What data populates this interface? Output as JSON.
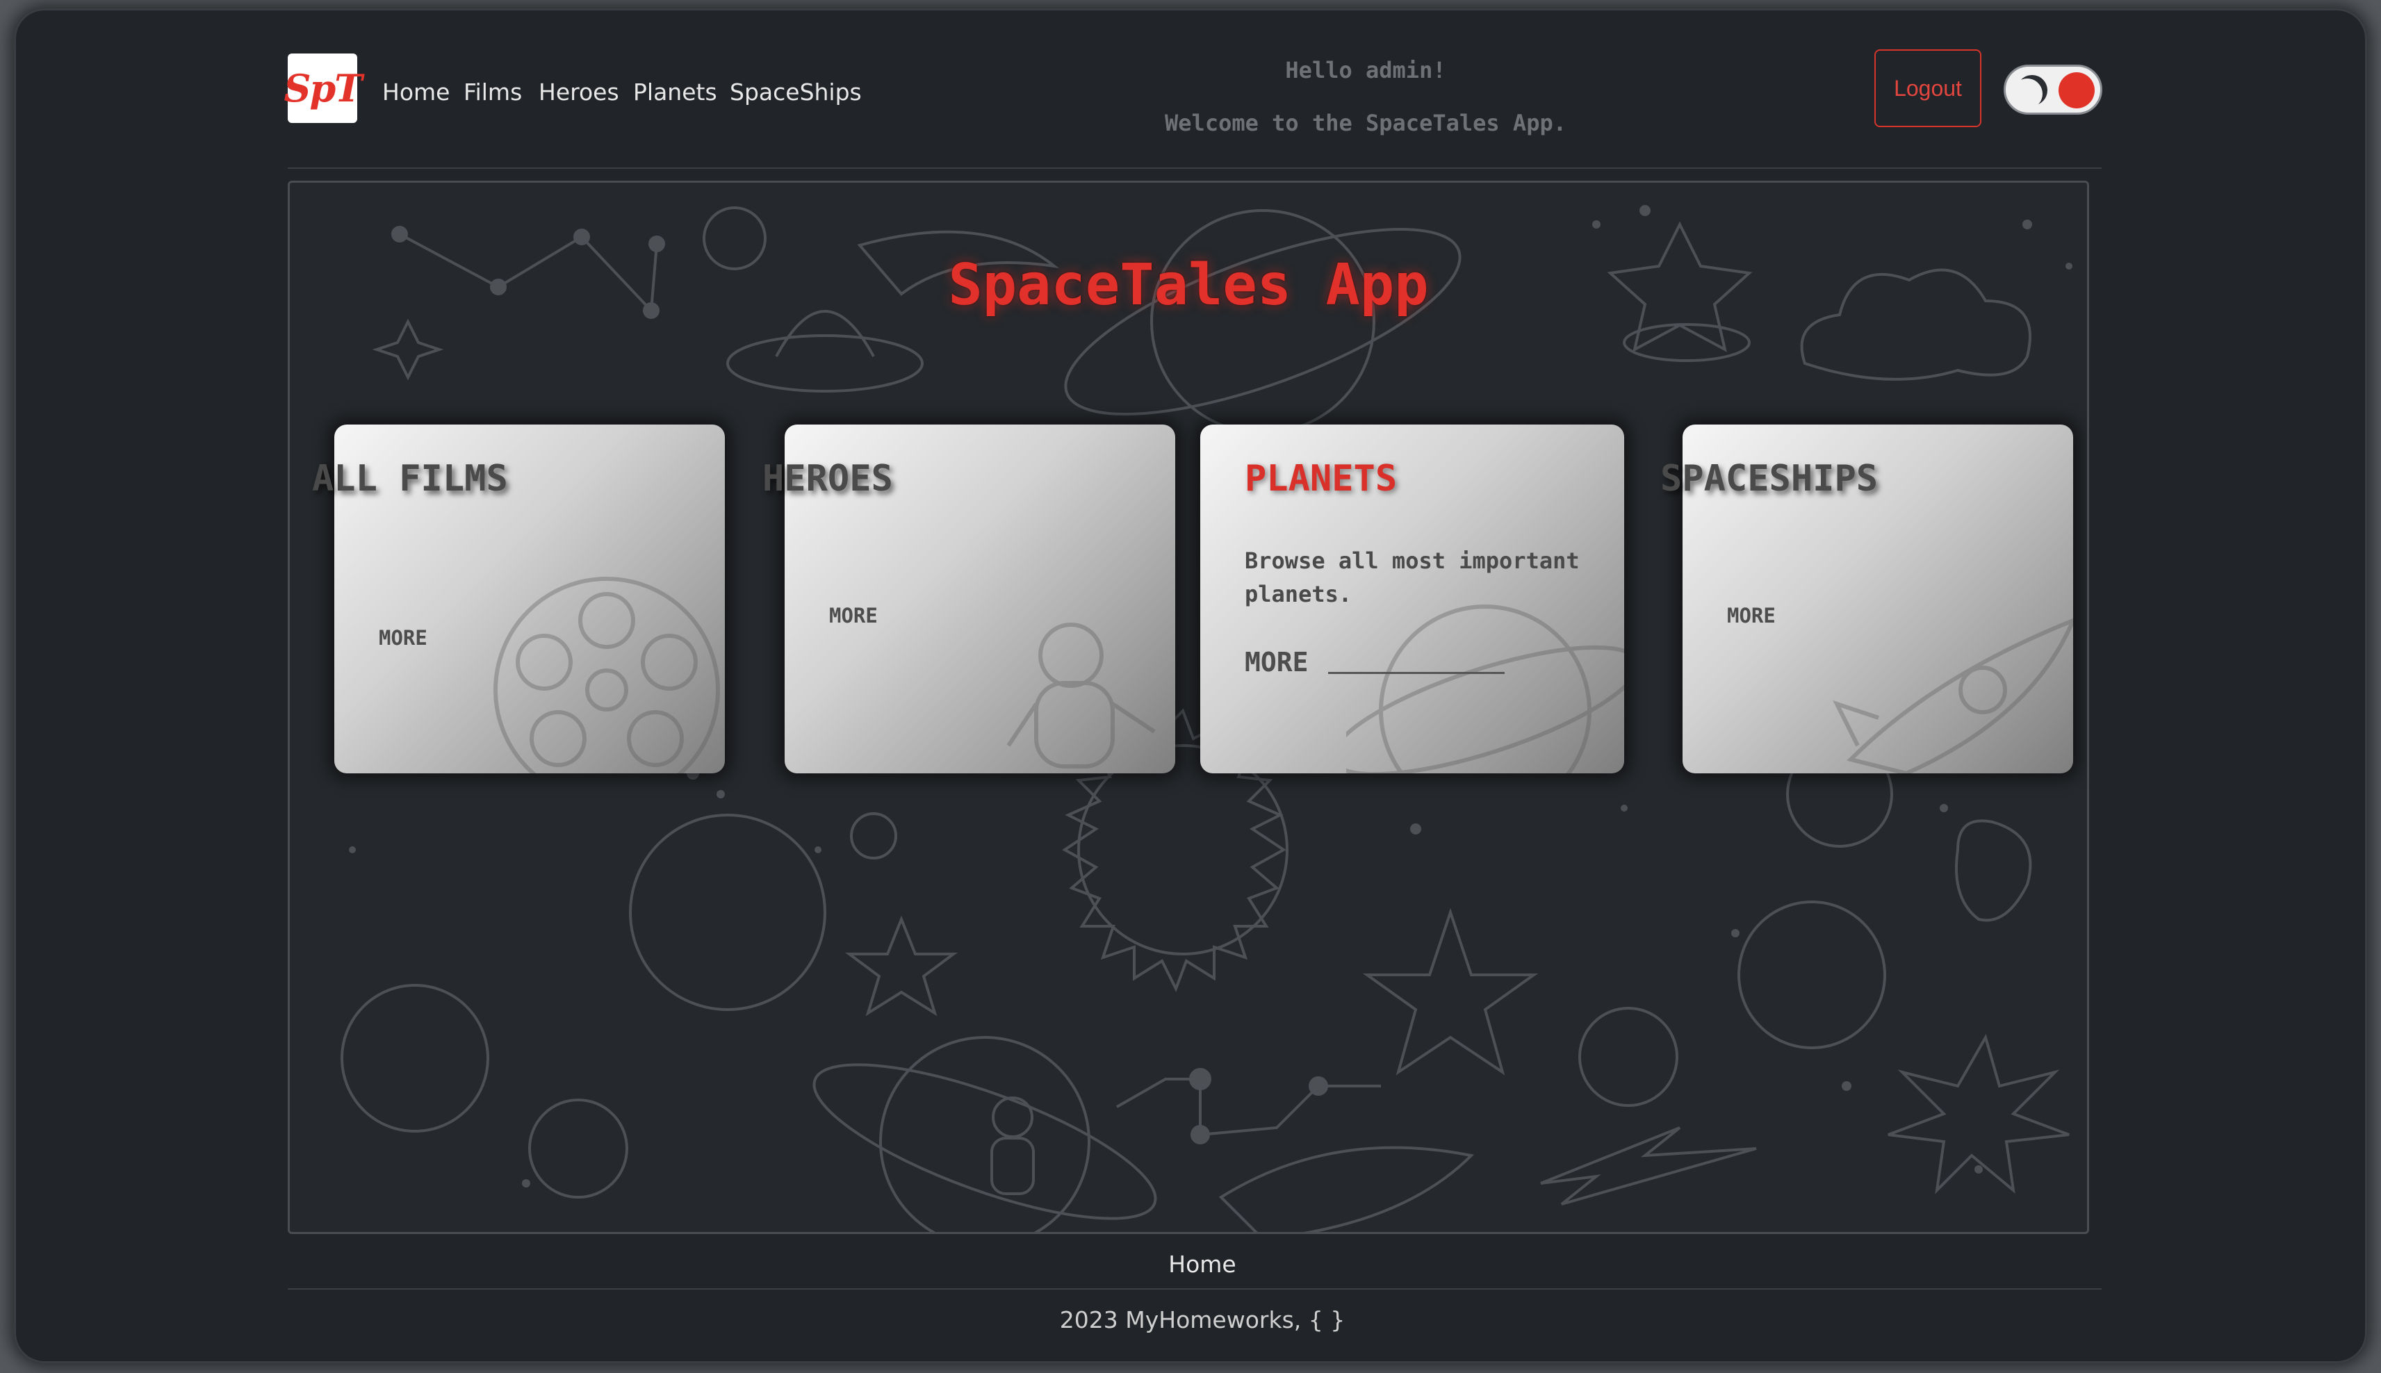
{
  "app": {
    "logo_text": "SpT"
  },
  "nav": {
    "items": [
      {
        "label": "Home"
      },
      {
        "label": "Films"
      },
      {
        "label": "Heroes"
      },
      {
        "label": "Planets"
      },
      {
        "label": "SpaceShips"
      }
    ]
  },
  "header": {
    "greeting": "Hello admin!",
    "welcome": "Welcome to the SpaceTales App.",
    "logout_label": "Logout",
    "theme_toggle": {
      "mode": "dark",
      "icon": "moon-icon"
    }
  },
  "hero": {
    "title": "SpaceTales App",
    "cards": [
      {
        "title": "ALL FILMS",
        "more": "MORE",
        "icon": "film-reel-icon"
      },
      {
        "title": "HEROES",
        "more": "MORE",
        "icon": "astronaut-icon"
      },
      {
        "title": "PLANETS",
        "description": "Browse all most important planets.",
        "more": "MORE",
        "icon": "planet-icon"
      },
      {
        "title": "SPACESHIPS",
        "more": "MORE",
        "icon": "rocket-icon"
      }
    ]
  },
  "footer": {
    "link": "Home",
    "copyright": "2023 MyHomeworks, { }"
  },
  "colors": {
    "accent": "#e2302a",
    "background": "#212428"
  }
}
